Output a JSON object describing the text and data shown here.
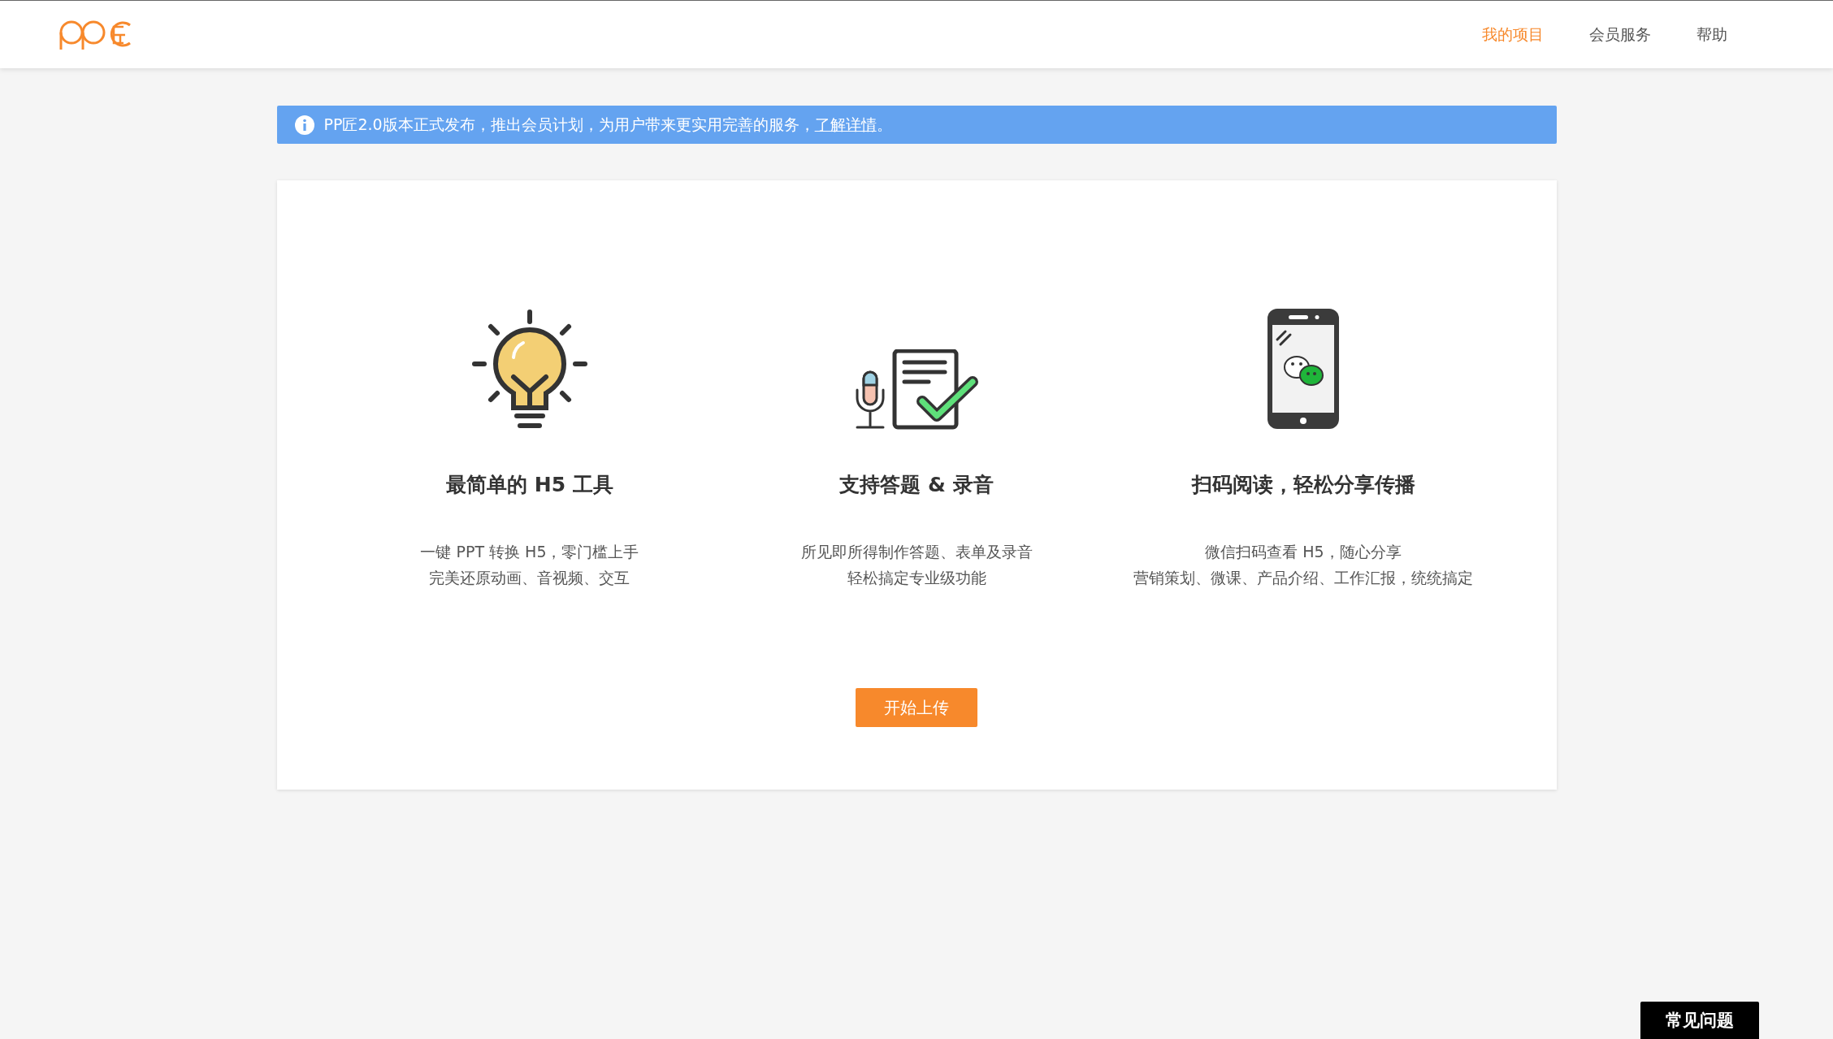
{
  "nav": [
    {
      "label": "我的项目",
      "selected": true
    },
    {
      "label": "会员服务",
      "selected": false
    },
    {
      "label": "帮助",
      "selected": false
    }
  ],
  "notice": {
    "text": "PP匠2.0版本正式发布，推出会员计划，为用户带来更实用完善的服务，",
    "link": "了解详情",
    "tail": "。"
  },
  "features": [
    {
      "kind": "bulb",
      "title": "最简单的 H5 工具",
      "lines": [
        "一键 PPT 转换 H5，零门槛上手",
        "完美还原动画、音视频、交互"
      ]
    },
    {
      "kind": "quiz",
      "title": "支持答题 & 录音",
      "lines": [
        "所见即所得制作答题、表单及录音",
        "轻松搞定专业级功能"
      ]
    },
    {
      "kind": "phone",
      "title": "扫码阅读，轻松分享传播",
      "lines": [
        "微信扫码查看 H5，随心分享",
        "营销策划、微课、产品介绍、工作汇报，统统搞定"
      ]
    }
  ],
  "upload_button": "开始上传",
  "faq_button": "常见问题"
}
